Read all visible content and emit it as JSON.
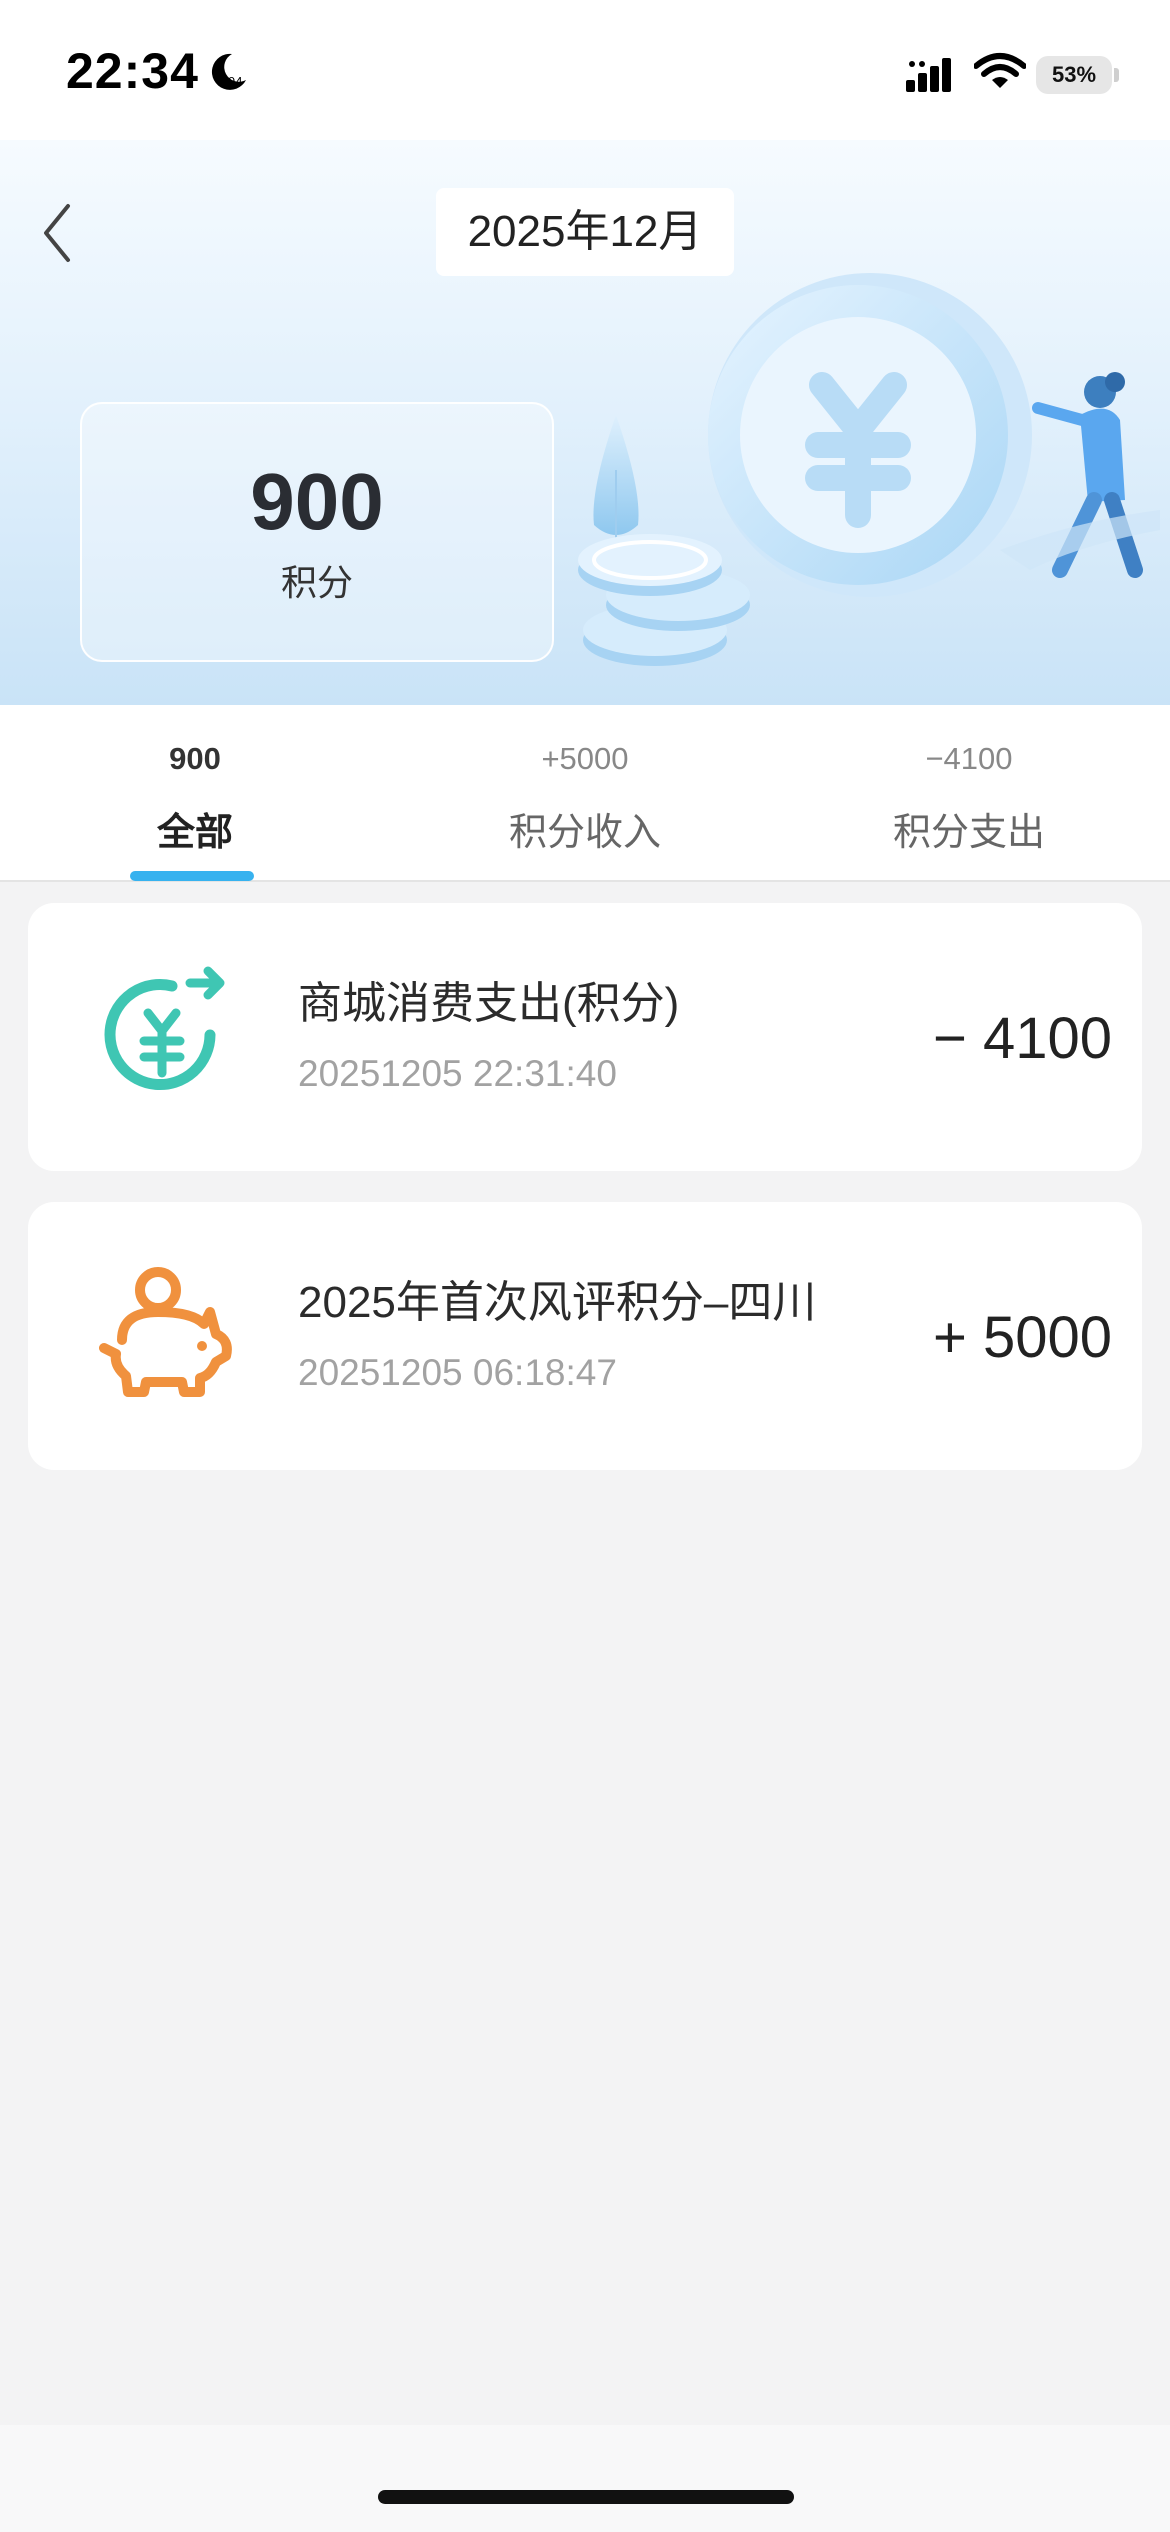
{
  "status_bar": {
    "time": "22:34",
    "moon_badge": "94",
    "battery": "53%"
  },
  "header": {
    "month": "2025年12月",
    "points_value": "900",
    "points_unit": "积分"
  },
  "tabs": [
    {
      "count": "900",
      "label": "全部",
      "active": true
    },
    {
      "count": "+5000",
      "label": "积分收入",
      "active": false
    },
    {
      "count": "−4100",
      "label": "积分支出",
      "active": false
    }
  ],
  "records": [
    {
      "icon": "yuan-exchange-icon",
      "title": "商城消费支出(积分)",
      "time": "20251205 22:31:40",
      "amount": "− 4100"
    },
    {
      "icon": "piggy-bank-icon",
      "title": "2025年首次风评积分–四川",
      "time": "20251205 06:18:47",
      "amount": "+ 5000"
    }
  ],
  "colors": {
    "accent": "#37b2ef",
    "teal_icon": "#3fc6b3",
    "orange_icon": "#f0913e"
  }
}
